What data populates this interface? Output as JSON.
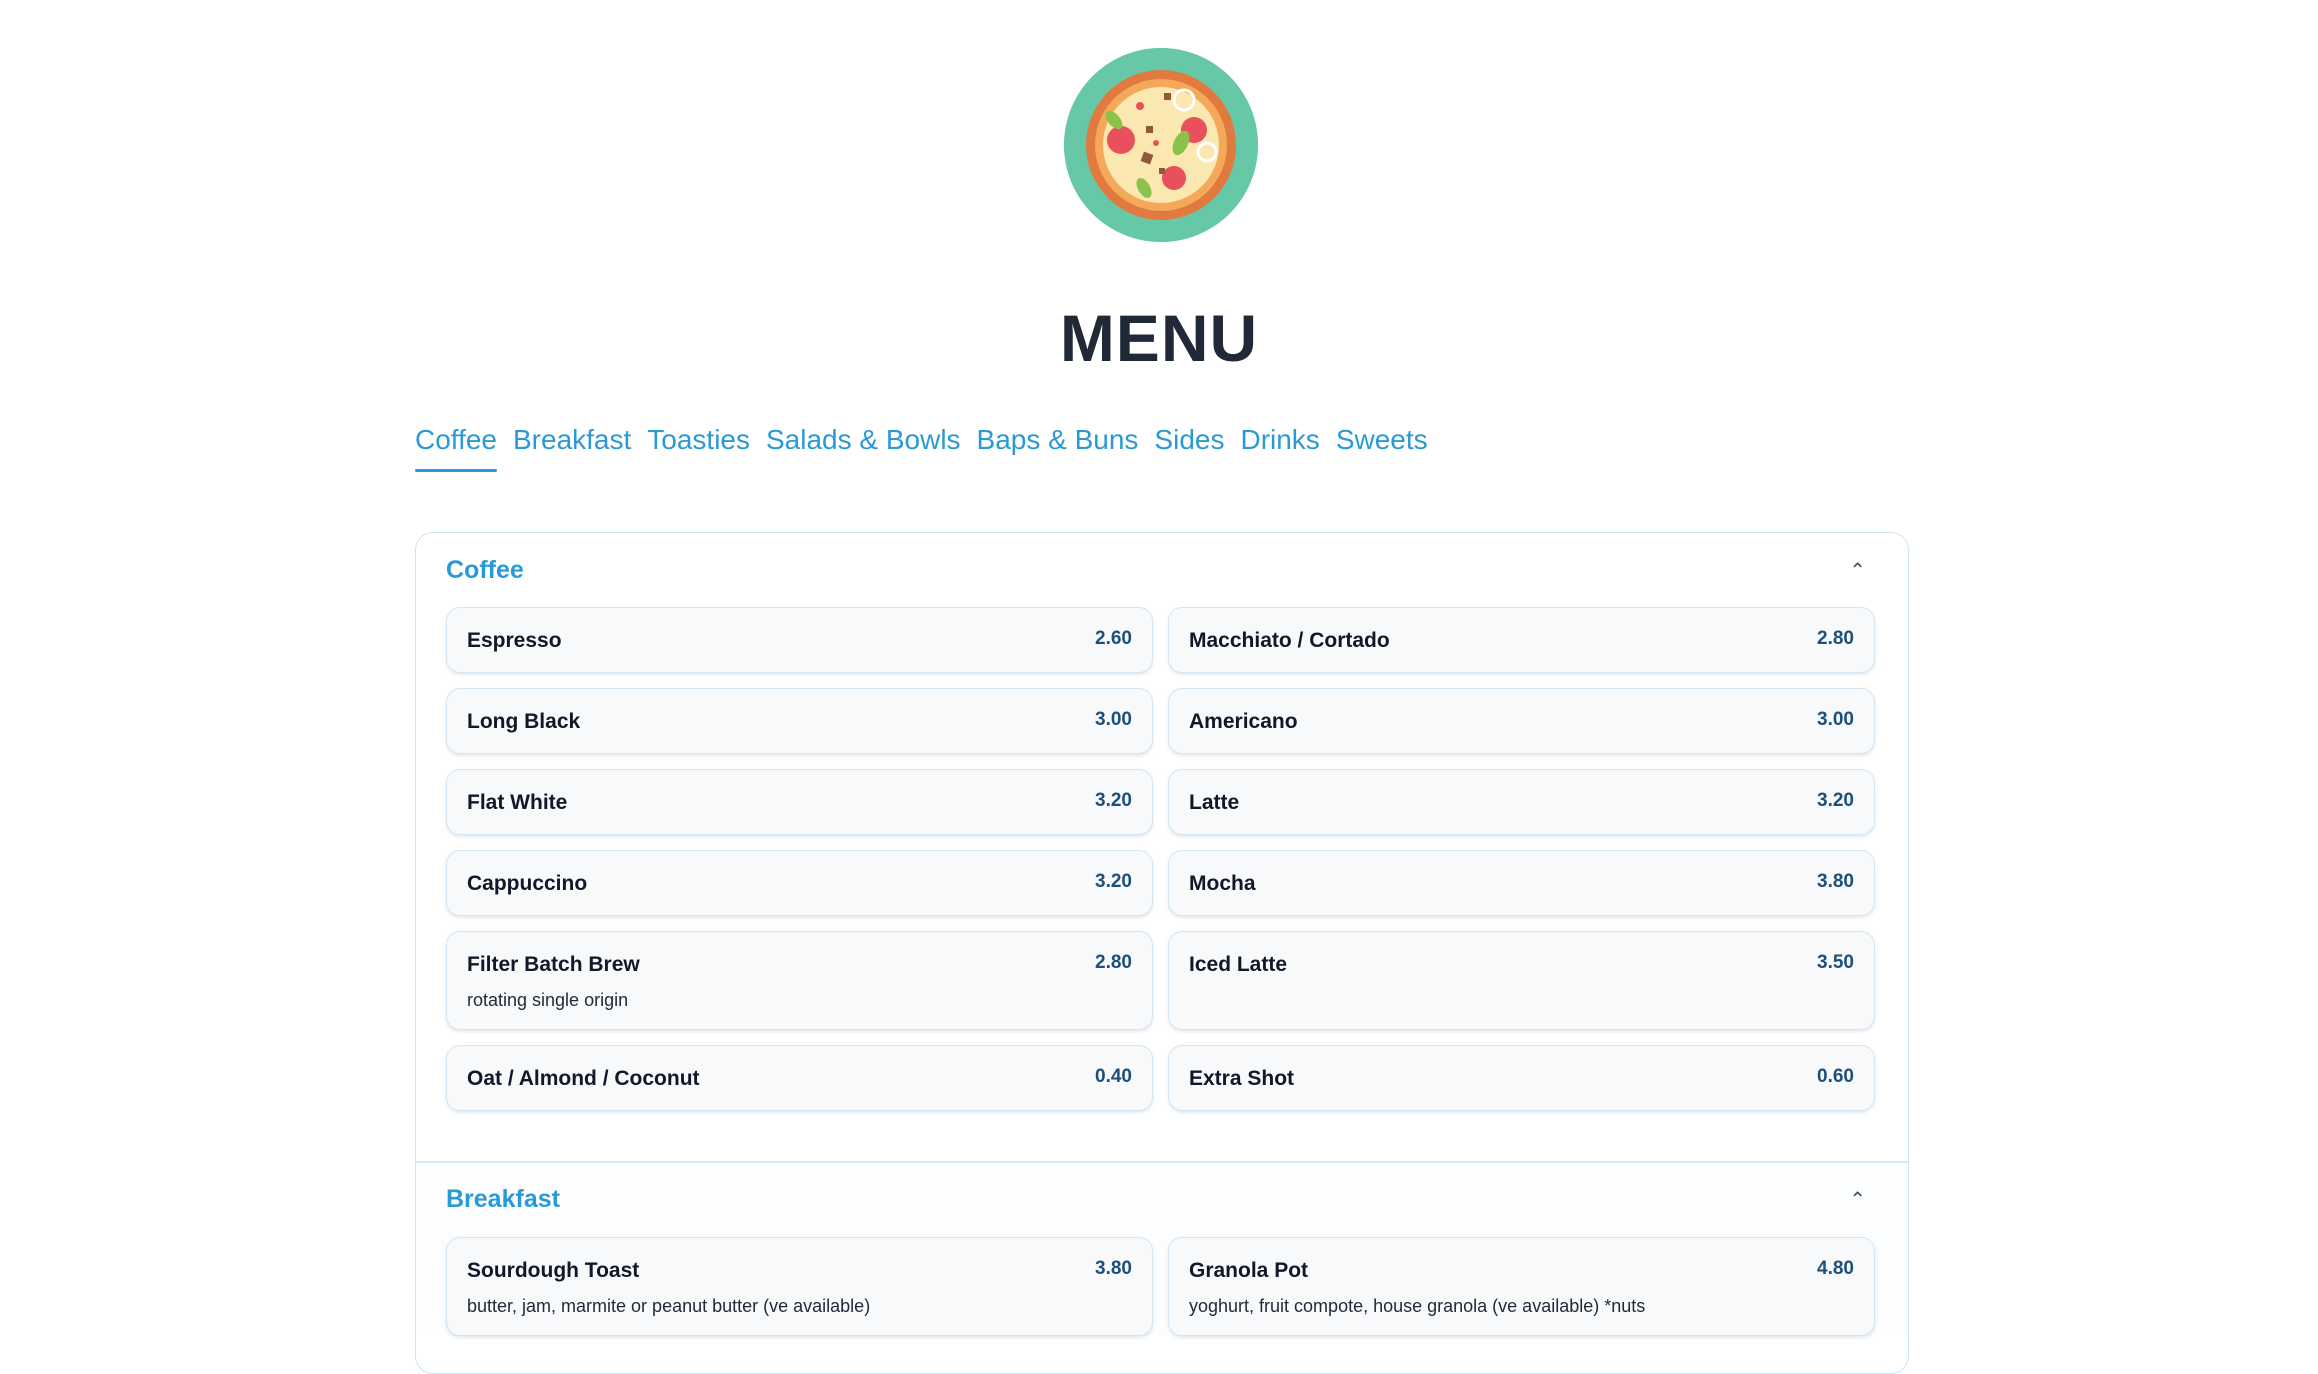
{
  "page": {
    "title": "MENU",
    "logo_icon": "pizza-icon",
    "colors": {
      "accent": "#2a9ad6",
      "logo_bg": "#66c8a6",
      "price": "#1e4f7a"
    }
  },
  "tabs": [
    {
      "label": "Coffee",
      "active": true
    },
    {
      "label": "Breakfast"
    },
    {
      "label": "Toasties"
    },
    {
      "label": "Salads & Bowls"
    },
    {
      "label": "Baps & Buns"
    },
    {
      "label": "Sides"
    },
    {
      "label": "Drinks"
    },
    {
      "label": "Sweets"
    }
  ],
  "sections": [
    {
      "title": "Coffee",
      "toggle_icon": "chevron-up-icon",
      "items": [
        {
          "name": "Espresso",
          "price": "2.60"
        },
        {
          "name": "Macchiato / Cortado",
          "price": "2.80"
        },
        {
          "name": "Long Black",
          "price": "3.00"
        },
        {
          "name": "Americano",
          "price": "3.00"
        },
        {
          "name": "Flat White",
          "price": "3.20"
        },
        {
          "name": "Latte",
          "price": "3.20"
        },
        {
          "name": "Cappuccino",
          "price": "3.20"
        },
        {
          "name": "Mocha",
          "price": "3.80"
        },
        {
          "name": "Filter Batch Brew",
          "price": "2.80",
          "desc": "rotating single origin"
        },
        {
          "name": "Iced Latte",
          "price": "3.50"
        },
        {
          "name": "Oat / Almond / Coconut",
          "price": "0.40"
        },
        {
          "name": "Extra Shot",
          "price": "0.60"
        }
      ]
    },
    {
      "title": "Breakfast",
      "toggle_icon": "chevron-up-icon",
      "items": [
        {
          "name": "Sourdough Toast",
          "price": "3.80",
          "desc": "butter, jam, marmite or peanut butter (ve available)"
        },
        {
          "name": "Granola Pot",
          "price": "4.80",
          "desc": "yoghurt, fruit compote, house granola (ve available) *nuts"
        }
      ]
    }
  ]
}
